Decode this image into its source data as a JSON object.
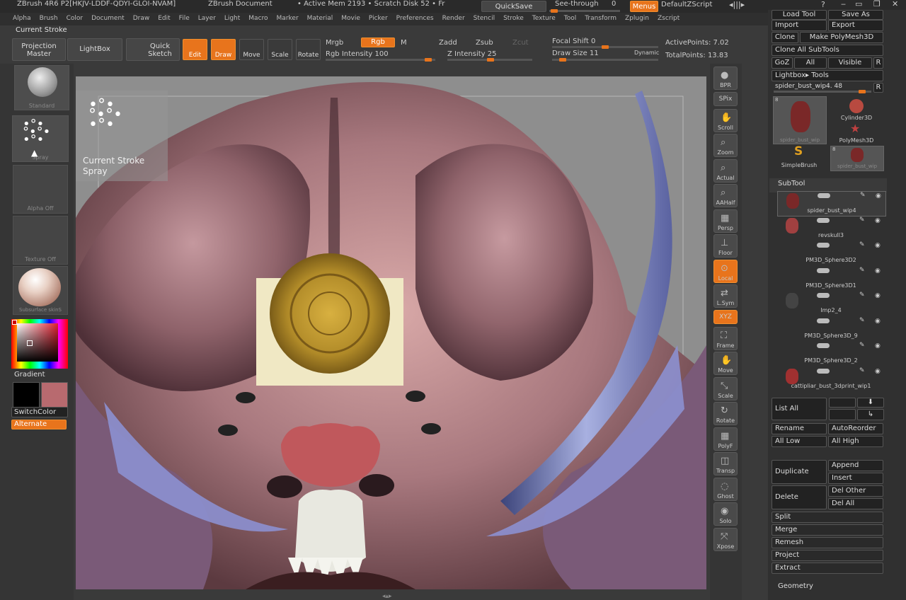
{
  "title_bar": {
    "app": "ZBrush 4R6 P2[HKJV-LDDF-QDYI-GLOI-NVAM]",
    "doc": "ZBrush Document",
    "mem": "• Active Mem 2193 • Scratch Disk 52 • Fr",
    "quicksave": "QuickSave",
    "see_through": "See-through",
    "see_through_value": "0",
    "menus": "Menus",
    "script": "DefaultZScript"
  },
  "menu_items": [
    "Alpha",
    "Brush",
    "Color",
    "Document",
    "Draw",
    "Edit",
    "File",
    "Layer",
    "Light",
    "Macro",
    "Marker",
    "Material",
    "Movie",
    "Picker",
    "Preferences",
    "Render",
    "Stencil",
    "Stroke",
    "Texture",
    "Tool",
    "Transform",
    "Zplugin",
    "Zscript"
  ],
  "current_stroke_label": "Current Stroke",
  "toolbar": {
    "projection_master": "Projection\nMaster",
    "lightbox": "LightBox",
    "quick_sketch": "Quick\nSketch",
    "edit": "Edit",
    "draw": "Draw",
    "move": "Move",
    "scale": "Scale",
    "rotate": "Rotate",
    "mrgb": "Mrgb",
    "rgb": "Rgb",
    "m": "M",
    "rgb_intensity": "Rgb Intensity 100",
    "zadd": "Zadd",
    "zsub": "Zsub",
    "zcut": "Zcut",
    "z_intensity": "Z Intensity 25",
    "focal_shift": "Focal Shift 0",
    "draw_size": "Draw Size 11",
    "dynamic": "Dynamic",
    "active_points": "ActivePoints: 7.02",
    "total_points": "TotalPoints: 13.83"
  },
  "left_shelf": {
    "brush": "Standard",
    "stroke": "Spray",
    "alpha": "Alpha Off",
    "texture": "Texture Off",
    "material": "Subsurface skinS",
    "gradient": "Gradient",
    "switch_color": "SwitchColor",
    "alternate": "Alternate"
  },
  "stroke_popup": {
    "title": "Current Stroke",
    "name": "Spray"
  },
  "right_shelf": [
    {
      "label": "BPR",
      "icon": "sphere-icon"
    },
    {
      "label": "SPix",
      "icon": "slider-icon"
    },
    {
      "label": "Scroll",
      "icon": "hand-icon"
    },
    {
      "label": "Zoom",
      "icon": "magnifier-icon"
    },
    {
      "label": "Actual",
      "icon": "magnifier-icon"
    },
    {
      "label": "AAHalf",
      "icon": "magnifier-icon"
    },
    {
      "label": "Persp",
      "icon": "grid-icon"
    },
    {
      "label": "Floor",
      "icon": "floor-icon"
    },
    {
      "label": "Local",
      "icon": "local-icon"
    },
    {
      "label": "L.Sym",
      "icon": "sym-icon"
    },
    {
      "label": "XYZ",
      "icon": "xyz-icon"
    },
    {
      "label": "Frame",
      "icon": "frame-icon"
    },
    {
      "label": "Move",
      "icon": "hand-icon"
    },
    {
      "label": "Scale",
      "icon": "scale-icon"
    },
    {
      "label": "Rotate",
      "icon": "rotate-icon"
    },
    {
      "label": "PolyF",
      "icon": "polyframe-icon"
    },
    {
      "label": "Transp",
      "icon": "transp-icon"
    },
    {
      "label": "Ghost",
      "icon": "ghost-icon"
    },
    {
      "label": "Solo",
      "icon": "solo-icon"
    },
    {
      "label": "Xpose",
      "icon": "xpose-icon"
    }
  ],
  "tool_panel": {
    "load_tool": "Load Tool",
    "save_as": "Save As",
    "import": "Import",
    "export": "Export",
    "clone": "Clone",
    "make_polymesh": "Make PolyMesh3D",
    "clone_all": "Clone All SubTools",
    "goz": "GoZ",
    "all": "All",
    "visible": "Visible",
    "r": "R",
    "lightbox_tools": "Lightbox▸ Tools",
    "current_tool": "spider_bust_wip4. 48",
    "thumbs": [
      "spider_bust_wip",
      "Cylinder3D",
      "PolyMesh3D",
      "SimpleBrush",
      "spider_bust_wip"
    ],
    "thumb_count": "8"
  },
  "subtool": {
    "header": "SubTool",
    "items": [
      "spider_bust_wip4",
      "revskull3",
      "PM3D_Sphere3D2",
      "PM3D_Sphere3D1",
      "Imp2_4",
      "PM3D_Sphere3D_9",
      "PM3D_Sphere3D_2",
      "cattipliar_bust_3dprint_wip1"
    ],
    "list_all": "List All",
    "rename": "Rename",
    "auto_reorder": "AutoReorder",
    "all_low": "All Low",
    "all_high": "All High",
    "duplicate": "Duplicate",
    "append": "Append",
    "insert": "Insert",
    "delete": "Delete",
    "del_other": "Del Other",
    "del_all": "Del All",
    "split": "Split",
    "merge": "Merge",
    "remesh": "Remesh",
    "project": "Project",
    "extract": "Extract",
    "geometry": "Geometry"
  },
  "colors": {
    "accent": "#e8741c",
    "primary_color": "#000000",
    "secondary_color": "#b86a6f"
  }
}
